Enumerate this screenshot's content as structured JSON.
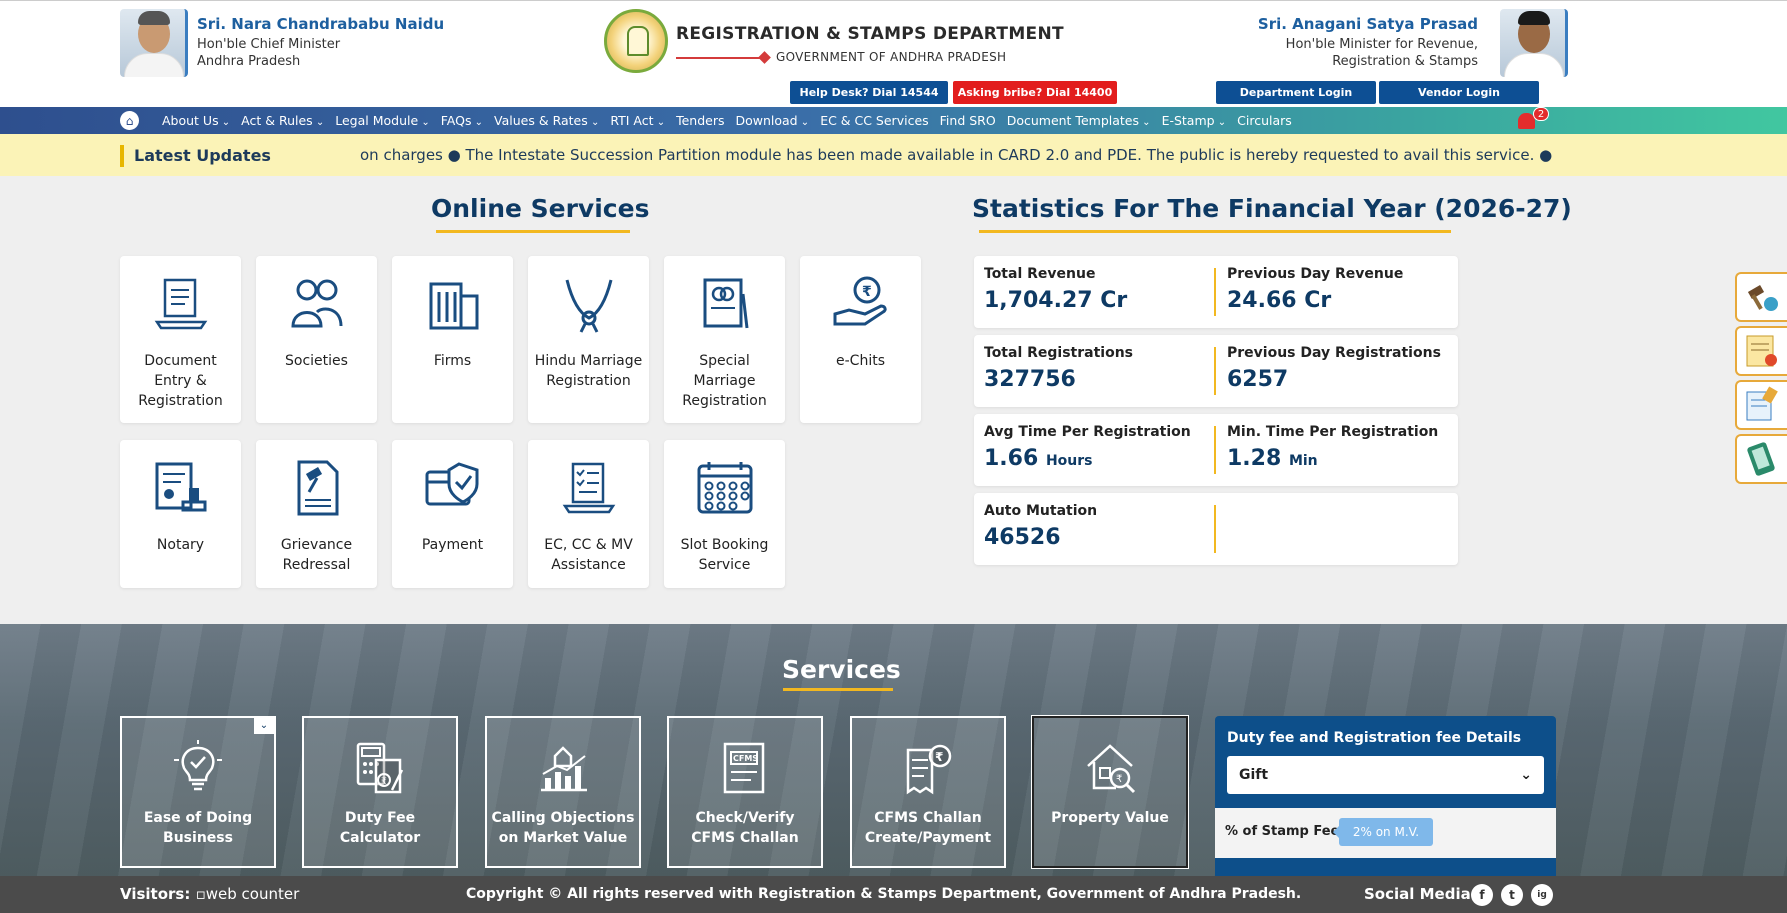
{
  "header": {
    "cm_name": "Sri. Nara Chandrababu Naidu",
    "cm_role": "Hon'ble Chief Minister",
    "cm_state": "Andhra Pradesh",
    "dept_title": "REGISTRATION & STAMPS DEPARTMENT",
    "dept_sub": "GOVERNMENT OF ANDHRA PRADESH",
    "minister_name": "Sri. Anagani Satya Prasad",
    "minister_role1": "Hon'ble Minister for Revenue,",
    "minister_role2": "Registration & Stamps",
    "help_desk": "Help Desk? Dial 14544",
    "bribe": "Asking bribe? Dial 14400",
    "dept_login": "Department Login",
    "vendor_login": "Vendor Login"
  },
  "nav": {
    "home_icon": "home-icon",
    "items": [
      "About Us",
      "Act & Rules",
      "Legal Module",
      "FAQs",
      "Values & Rates",
      "RTI Act",
      "Tenders",
      "Download",
      "EC & CC Services",
      "Find SRO",
      "Document Templates",
      "E-Stamp",
      "Circulars"
    ],
    "dropdown_flags": [
      true,
      true,
      true,
      true,
      true,
      true,
      false,
      true,
      false,
      false,
      true,
      true,
      false
    ],
    "notification_count": "2"
  },
  "updates": {
    "label": "Latest Updates",
    "ticker_text": "on charges   ●  The Intestate Succession Partition module has been made available in CARD 2.0 and PDE. The public is hereby requested to avail this service.   ●  Citizens ar"
  },
  "online_services": {
    "title": "Online Services",
    "cards": [
      {
        "label": "Document Entry & Registration",
        "icon": "document-laptop-icon"
      },
      {
        "label": "Societies",
        "icon": "people-icon"
      },
      {
        "label": "Firms",
        "icon": "building-icon"
      },
      {
        "label": "Hindu Marriage Registration",
        "icon": "garland-icon"
      },
      {
        "label": "Special Marriage Registration",
        "icon": "certificate-rings-icon"
      },
      {
        "label": "e-Chits",
        "icon": "rupee-hand-icon"
      },
      {
        "label": "Notary",
        "icon": "notary-stamp-icon"
      },
      {
        "label": "Grievance Redressal",
        "icon": "gavel-document-icon"
      },
      {
        "label": "Payment",
        "icon": "payment-shield-icon"
      },
      {
        "label": "EC, CC & MV Assistance",
        "icon": "checklist-laptop-icon"
      },
      {
        "label": "Slot Booking Service",
        "icon": "calendar-icon"
      }
    ]
  },
  "statistics": {
    "title": "Statistics For The Financial Year (2026-27)",
    "rows": [
      {
        "left_label": "Total Revenue",
        "left_value": "1,704.27 Cr",
        "left_unit": "",
        "right_label": "Previous Day Revenue",
        "right_value": "24.66 Cr",
        "right_unit": ""
      },
      {
        "left_label": "Total Registrations",
        "left_value": "327756",
        "left_unit": "",
        "right_label": "Previous Day Registrations",
        "right_value": "6257",
        "right_unit": ""
      },
      {
        "left_label": "Avg Time Per Registration",
        "left_value": "1.66",
        "left_unit": "Hours",
        "right_label": "Min. Time Per Registration",
        "right_value": "1.28",
        "right_unit": "Min"
      },
      {
        "left_label": "Auto Mutation",
        "left_value": "46526",
        "left_unit": "",
        "right_label": "",
        "right_value": "",
        "right_unit": ""
      }
    ]
  },
  "services": {
    "title": "Services",
    "cards": [
      {
        "label": "Ease of Doing Business",
        "icon": "lightbulb-check-icon"
      },
      {
        "label": "Duty Fee Calculator",
        "icon": "calculator-icon"
      },
      {
        "label": "Calling Objections on Market Value",
        "icon": "bar-chart-house-icon"
      },
      {
        "label": "Check/Verify CFMS Challan",
        "icon": "cfms-document-icon"
      },
      {
        "label": "CFMS Challan Create/Payment",
        "icon": "rupee-receipt-icon"
      },
      {
        "label": "Property Value",
        "icon": "house-search-icon"
      }
    ],
    "duty_panel": {
      "title": "Duty fee and Registration fee Details",
      "selected": "Gift",
      "stamp_fee_label": "% of Stamp Fee",
      "stamp_fee_value": "2% on M.V."
    }
  },
  "footer": {
    "visitors_label": "Visitors:",
    "counter_alt": "web counter",
    "copyright": "Copyright © All rights reserved with Registration & Stamps Department, Government of Andhra Pradesh.",
    "social_label": "Social Media",
    "social": [
      "f",
      "t",
      "ig"
    ]
  },
  "colors": {
    "primary": "#0e3a64",
    "accent": "#f2b820",
    "danger": "#e21d1d",
    "button_blue": "#0d4f94"
  }
}
